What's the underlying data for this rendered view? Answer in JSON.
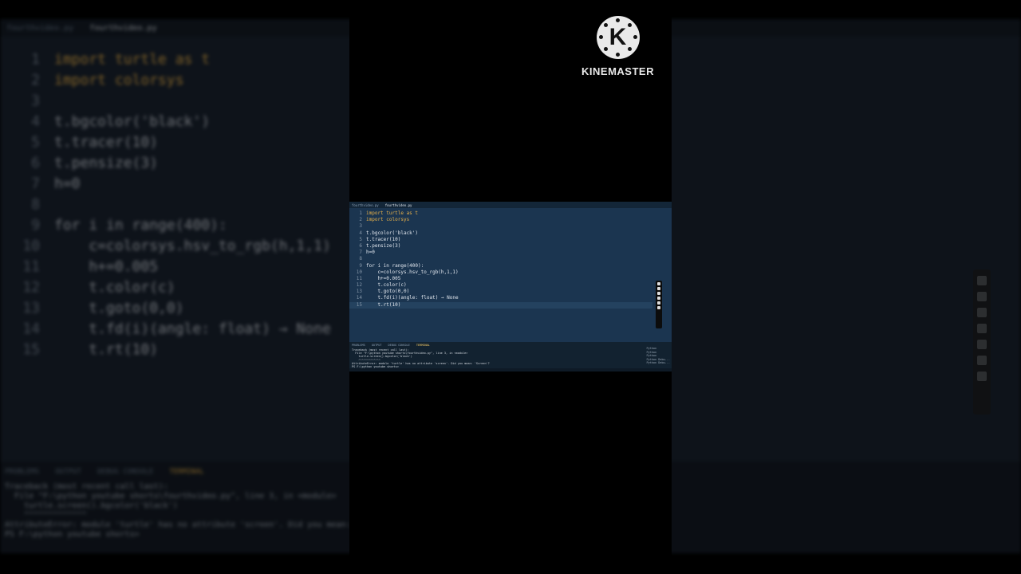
{
  "background_editor": {
    "tabs": [
      "fourthvideo.py",
      "fourthvideo.py"
    ],
    "lines": [
      {
        "n": "1",
        "text": "import turtle as t"
      },
      {
        "n": "2",
        "text": "import colorsys"
      },
      {
        "n": "3",
        "text": ""
      },
      {
        "n": "4",
        "text": "t.bgcolor('black')"
      },
      {
        "n": "5",
        "text": "t.tracer(10)"
      },
      {
        "n": "6",
        "text": "t.pensize(3)"
      },
      {
        "n": "7",
        "text": "h=0"
      },
      {
        "n": "8",
        "text": ""
      },
      {
        "n": "9",
        "text": "for i in range(400):"
      },
      {
        "n": "10",
        "text": "    c=colorsys.hsv_to_rgb(h,1,1)"
      },
      {
        "n": "11",
        "text": "    h+=0.005"
      },
      {
        "n": "12",
        "text": "    t.color(c)"
      },
      {
        "n": "13",
        "text": "    t.goto(0,0)"
      },
      {
        "n": "14",
        "text": "    t.fd(i)(angle: float) → None"
      },
      {
        "n": "15",
        "text": "    t.rt(10)"
      }
    ],
    "panel_tabs": [
      "PROBLEMS",
      "OUTPUT",
      "DEBUG CONSOLE",
      "TERMINAL"
    ],
    "terminal": [
      "Traceback (most recent call last):",
      "  File \"F:\\python youtube shorts\\fourthvideo.py\", line 3, in <module>",
      "    turtle.screen().bgcolor('black')",
      "    ^^^^^^^^^^^^^",
      "AttributeError: module 'turtle' has no attribute 'screen'. Did you mean: 'Scre",
      "PS F:\\python youtube shorts>"
    ]
  },
  "logo": {
    "letter": "K",
    "word": "KINEMASTER"
  },
  "editor": {
    "tabs": [
      "fourthvideo.py",
      "fourthvideo.py"
    ],
    "lines": [
      {
        "n": "1",
        "text": "import turtle as t"
      },
      {
        "n": "2",
        "text": "import colorsys"
      },
      {
        "n": "3",
        "text": ""
      },
      {
        "n": "4",
        "text": "t.bgcolor('black')"
      },
      {
        "n": "5",
        "text": "t.tracer(10)"
      },
      {
        "n": "6",
        "text": "t.pensize(3)"
      },
      {
        "n": "7",
        "text": "h=0"
      },
      {
        "n": "8",
        "text": ""
      },
      {
        "n": "9",
        "text": "for i in range(400):"
      },
      {
        "n": "10",
        "text": "    c=colorsys.hsv_to_rgb(h,1,1)"
      },
      {
        "n": "11",
        "text": "    h+=0.005"
      },
      {
        "n": "12",
        "text": "    t.color(c)"
      },
      {
        "n": "13",
        "text": "    t.goto(0,0)"
      },
      {
        "n": "14",
        "text": "    t.fd(i)(angle: float) → None"
      },
      {
        "n": "15",
        "text": "    t.rt(10)"
      }
    ],
    "current_line": "15",
    "panel_tabs": [
      "PROBLEMS",
      "OUTPUT",
      "DEBUG CONSOLE",
      "TERMINAL"
    ],
    "terminal": [
      "Traceback (most recent call last):",
      "  File \"F:\\python youtube shorts\\fourthvideo.py\", line 3, in <module>",
      "    turtle.screen().bgcolor('black')",
      "    ^^^^^^^^^^^^^",
      "AttributeError: module 'turtle' has no attribute 'screen'. Did you mean: 'Screen'?",
      "PS F:\\python youtube shorts>"
    ],
    "terminal_list": [
      "Python",
      "Python",
      "Python",
      "Python Debu...",
      "Python Debu..."
    ]
  },
  "colors": {
    "editor_bg": "#1b3550",
    "keyword": "#e8b14a",
    "number": "#e06c75"
  }
}
